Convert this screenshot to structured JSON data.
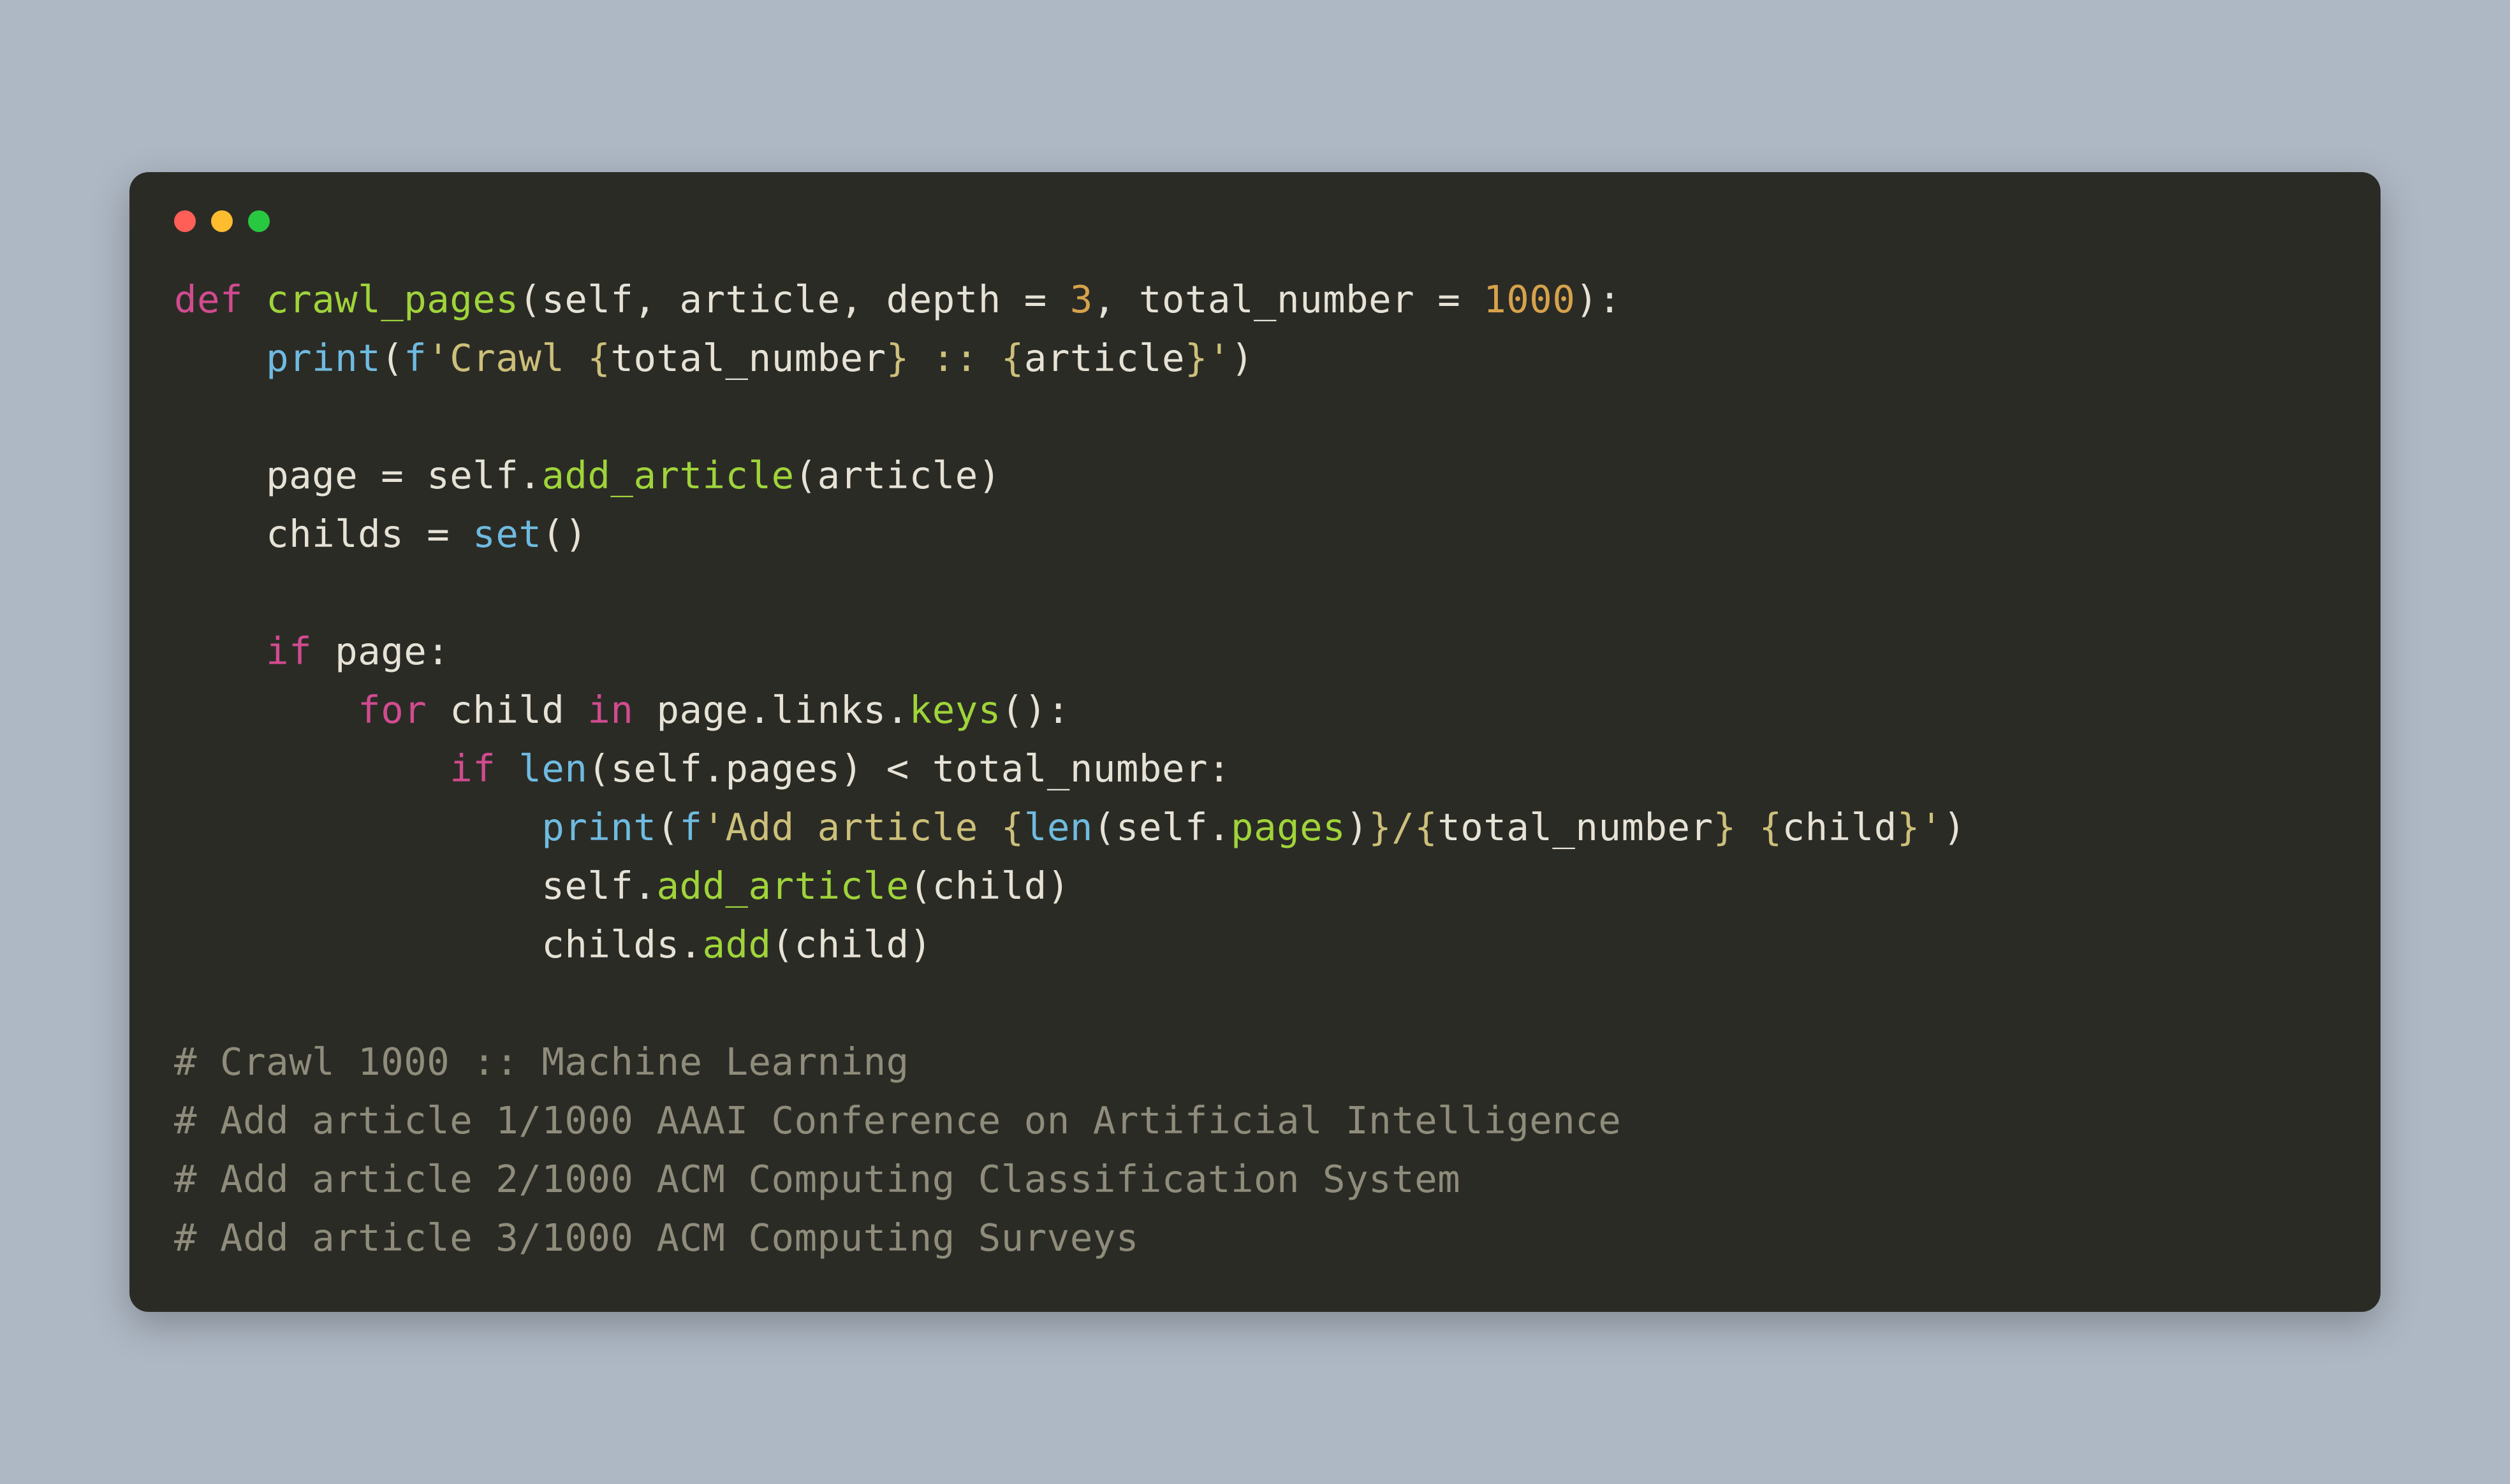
{
  "window": {
    "traffic_lights": [
      "close",
      "minimize",
      "zoom"
    ]
  },
  "code": {
    "line1": {
      "def": "def",
      "name": "crawl_pages",
      "params_open": "(self, article, depth = ",
      "depth_val": "3",
      "params_mid": ", total_number = ",
      "total_val": "1000",
      "params_close": "):"
    },
    "line2": {
      "indent": "    ",
      "print": "print",
      "open": "(",
      "fprefix": "f",
      "str1": "'Crawl ",
      "interp1_open": "{",
      "interp1_var": "total_number",
      "interp1_close": "}",
      "str2": " :: ",
      "interp2_open": "{",
      "interp2_var": "article",
      "interp2_close": "}",
      "str3": "'",
      "close": ")"
    },
    "line4": {
      "indent": "    ",
      "lhs": "page = self.",
      "method": "add_article",
      "args": "(article)"
    },
    "line5": {
      "indent": "    ",
      "lhs": "childs = ",
      "set": "set",
      "args": "()"
    },
    "line7": {
      "indent": "    ",
      "if": "if",
      "cond": " page:"
    },
    "line8": {
      "indent": "        ",
      "for": "for",
      "mid1": " child ",
      "in": "in",
      "mid2": " page.links.",
      "keys": "keys",
      "args": "():"
    },
    "line9": {
      "indent": "            ",
      "if": "if",
      "sp": " ",
      "len": "len",
      "args": "(self.pages) < total_number:"
    },
    "line10": {
      "indent": "                ",
      "print": "print",
      "open": "(",
      "fprefix": "f",
      "s1": "'Add article ",
      "i1o": "{",
      "len": "len",
      "lenarg_open": "(self.",
      "pages": "pages",
      "lenarg_close": ")",
      "i1c": "}",
      "s2": "/",
      "i2o": "{",
      "i2v": "total_number",
      "i2c": "}",
      "s3": " ",
      "i3o": "{",
      "i3v": "child",
      "i3c": "}",
      "s4": "'",
      "close": ")"
    },
    "line11": {
      "indent": "                ",
      "obj": "self.",
      "method": "add_article",
      "args": "(child)"
    },
    "line12": {
      "indent": "                ",
      "obj": "childs.",
      "method": "add",
      "args": "(child)"
    }
  },
  "comments": {
    "c1": "# Crawl 1000 :: Machine Learning",
    "c2": "# Add article 1/1000 AAAI Conference on Artificial Intelligence",
    "c3": "# Add article 2/1000 ACM Computing Classification System",
    "c4": "# Add article 3/1000 ACM Computing Surveys"
  }
}
